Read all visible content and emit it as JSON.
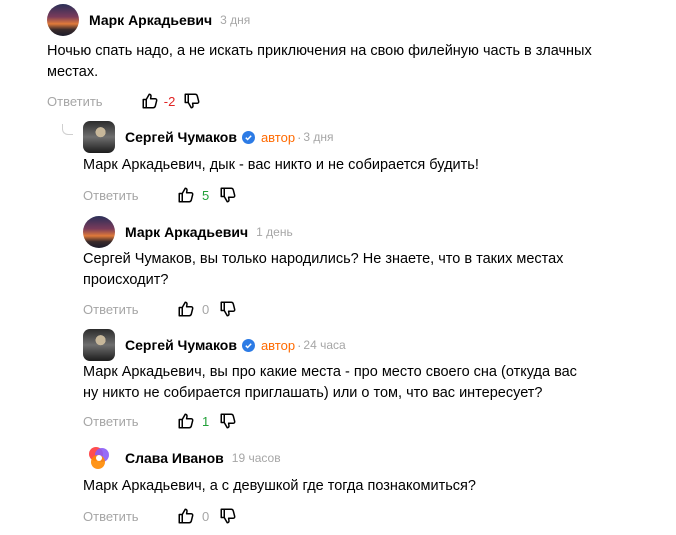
{
  "comments": [
    {
      "author": "Марк Аркадьевич",
      "time": "3 дня",
      "text_lines": [
        "Ночью спать надо, а не искать приключения на свою филейную часть в злачных",
        "местах."
      ],
      "reply_label": "Ответить",
      "score": "-2",
      "avatar_icon": "sunset-avatar"
    },
    {
      "author": "Сергей Чумаков",
      "role": "автор",
      "time": "3 дня",
      "text_lines": [
        "Марк Аркадьевич, дык - вас никто и не собирается будить!"
      ],
      "reply_label": "Ответить",
      "score": "5",
      "avatar_icon": "photo-avatar"
    },
    {
      "author": "Марк Аркадьевич",
      "time": "1 день",
      "text_lines": [
        "Сергей Чумаков, вы только народились? Не знаете, что в таких местах",
        "происходит?"
      ],
      "reply_label": "Ответить",
      "score": "0",
      "avatar_icon": "sunset-avatar"
    },
    {
      "author": "Сергей Чумаков",
      "role": "автор",
      "time": "24 часа",
      "text_lines": [
        "Марк Аркадьевич, вы про какие места - про место своего сна (откуда вас",
        "ну никто не собирается приглашать) или о том, что вас интересует?"
      ],
      "reply_label": "Ответить",
      "score": "1",
      "avatar_icon": "photo-avatar"
    },
    {
      "author": "Слава Иванов",
      "time": "19 часов",
      "text_lines": [
        "Марк Аркадьевич, а с девушкой где тогда познакомиться?"
      ],
      "reply_label": "Ответить",
      "score": "0",
      "avatar_icon": "colorful-avatar"
    }
  ],
  "colors": {
    "author_role": "#ff6a00",
    "score_negative": "#e02424",
    "score_positive": "#21a038",
    "muted": "#a6a6a6",
    "verified": "#2c7be5"
  }
}
